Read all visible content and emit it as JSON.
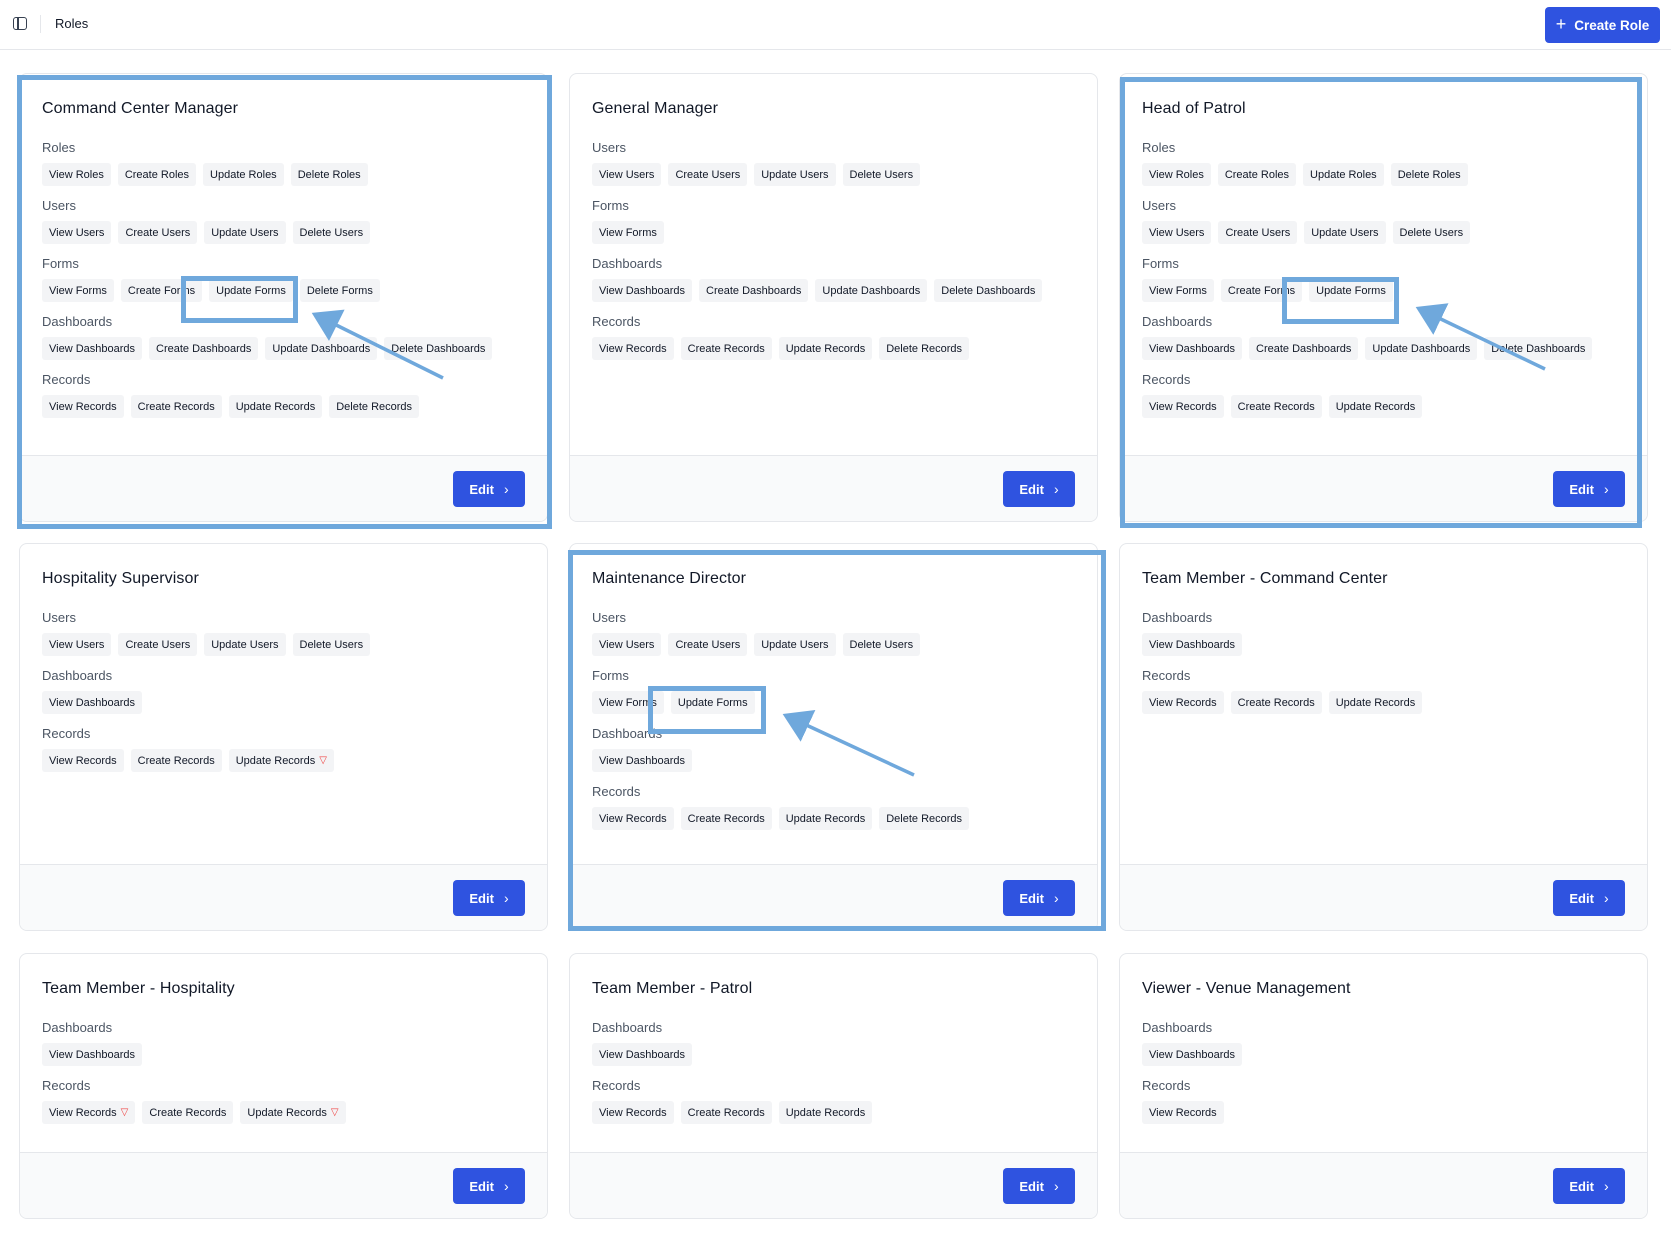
{
  "header": {
    "breadcrumb": "Roles",
    "create_label": "Create Role"
  },
  "edit_label": "Edit",
  "cards": [
    {
      "title": "Command Center Manager",
      "sections": [
        {
          "label": "Roles",
          "chips": [
            "View Roles",
            "Create Roles",
            "Update Roles",
            "Delete Roles"
          ]
        },
        {
          "label": "Users",
          "chips": [
            "View Users",
            "Create Users",
            "Update Users",
            "Delete Users"
          ]
        },
        {
          "label": "Forms",
          "chips": [
            "View Forms",
            "Create Forms",
            "Update Forms",
            "Delete Forms"
          ]
        },
        {
          "label": "Dashboards",
          "chips": [
            "View Dashboards",
            "Create Dashboards",
            "Update Dashboards",
            "Delete Dashboards"
          ]
        },
        {
          "label": "Records",
          "chips": [
            "View Records",
            "Create Records",
            "Update Records",
            "Delete Records"
          ]
        }
      ]
    },
    {
      "title": "General Manager",
      "sections": [
        {
          "label": "Users",
          "chips": [
            "View Users",
            "Create Users",
            "Update Users",
            "Delete Users"
          ]
        },
        {
          "label": "Forms",
          "chips": [
            "View Forms"
          ]
        },
        {
          "label": "Dashboards",
          "chips": [
            "View Dashboards",
            "Create Dashboards",
            "Update Dashboards",
            "Delete Dashboards"
          ]
        },
        {
          "label": "Records",
          "chips": [
            "View Records",
            "Create Records",
            "Update Records",
            "Delete Records"
          ]
        }
      ]
    },
    {
      "title": "Head of Patrol",
      "sections": [
        {
          "label": "Roles",
          "chips": [
            "View Roles",
            "Create Roles",
            "Update Roles",
            "Delete Roles"
          ]
        },
        {
          "label": "Users",
          "chips": [
            "View Users",
            "Create Users",
            "Update Users",
            "Delete Users"
          ]
        },
        {
          "label": "Forms",
          "chips": [
            "View Forms",
            "Create Forms",
            "Update Forms"
          ]
        },
        {
          "label": "Dashboards",
          "chips": [
            "View Dashboards",
            "Create Dashboards",
            "Update Dashboards",
            "Delete Dashboards"
          ]
        },
        {
          "label": "Records",
          "chips": [
            "View Records",
            "Create Records",
            "Update Records"
          ]
        }
      ]
    },
    {
      "title": "Hospitality Supervisor",
      "sections": [
        {
          "label": "Users",
          "chips": [
            "View Users",
            "Create Users",
            "Update Users",
            "Delete Users"
          ]
        },
        {
          "label": "Dashboards",
          "chips": [
            "View Dashboards"
          ]
        },
        {
          "label": "Records",
          "chips": [
            "View Records",
            "Create Records",
            "Update Records"
          ],
          "filtered": [
            2
          ]
        }
      ]
    },
    {
      "title": "Maintenance Director",
      "sections": [
        {
          "label": "Users",
          "chips": [
            "View Users",
            "Create Users",
            "Update Users",
            "Delete Users"
          ]
        },
        {
          "label": "Forms",
          "chips": [
            "View Forms",
            "Update Forms"
          ]
        },
        {
          "label": "Dashboards",
          "chips": [
            "View Dashboards"
          ]
        },
        {
          "label": "Records",
          "chips": [
            "View Records",
            "Create Records",
            "Update Records",
            "Delete Records"
          ]
        }
      ]
    },
    {
      "title": "Team Member - Command Center",
      "sections": [
        {
          "label": "Dashboards",
          "chips": [
            "View Dashboards"
          ]
        },
        {
          "label": "Records",
          "chips": [
            "View Records",
            "Create Records",
            "Update Records"
          ]
        }
      ]
    },
    {
      "title": "Team Member - Hospitality",
      "sections": [
        {
          "label": "Dashboards",
          "chips": [
            "View Dashboards"
          ]
        },
        {
          "label": "Records",
          "chips": [
            "View Records",
            "Create Records",
            "Update Records"
          ],
          "filtered": [
            0,
            2
          ]
        }
      ]
    },
    {
      "title": "Team Member - Patrol",
      "sections": [
        {
          "label": "Dashboards",
          "chips": [
            "View Dashboards"
          ]
        },
        {
          "label": "Records",
          "chips": [
            "View Records",
            "Create Records",
            "Update Records"
          ]
        }
      ]
    },
    {
      "title": "Viewer - Venue Management",
      "sections": [
        {
          "label": "Dashboards",
          "chips": [
            "View Dashboards"
          ]
        },
        {
          "label": "Records",
          "chips": [
            "View Records"
          ]
        }
      ]
    }
  ],
  "icons": {
    "sidebar_toggle": "sidebar-toggle-icon",
    "plus": "plus-icon",
    "chevron": "chevron-right-icon",
    "filter": "filter-icon"
  },
  "colors": {
    "primary": "#2f53e0",
    "annotation": "#6fa8dc",
    "filter": "#ef4444"
  }
}
